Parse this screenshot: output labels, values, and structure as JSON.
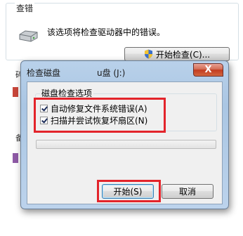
{
  "background": {
    "group_title": "查错",
    "description": "该选项将检查驱动器中的错误。",
    "check_button_label": "开始检查(C)...",
    "edge_chars": [
      "碎",
      "备"
    ]
  },
  "dialog": {
    "title": "检查磁盘",
    "title_drive": "u盘 (J:)",
    "close_label": "X",
    "options_group_title": "磁盘检查选项",
    "options": [
      {
        "label": "自动修复文件系统错误(A)",
        "checked": true
      },
      {
        "label": "扫描并尝试恢复坏扇区(N)",
        "checked": true
      }
    ],
    "progress_percent": 0,
    "start_button_label": "开始(S)",
    "cancel_button_label": "取消"
  },
  "colors": {
    "highlight": "#e3242b",
    "dialog_frame": "#aac6e3",
    "close_button": "#c23b1f"
  }
}
